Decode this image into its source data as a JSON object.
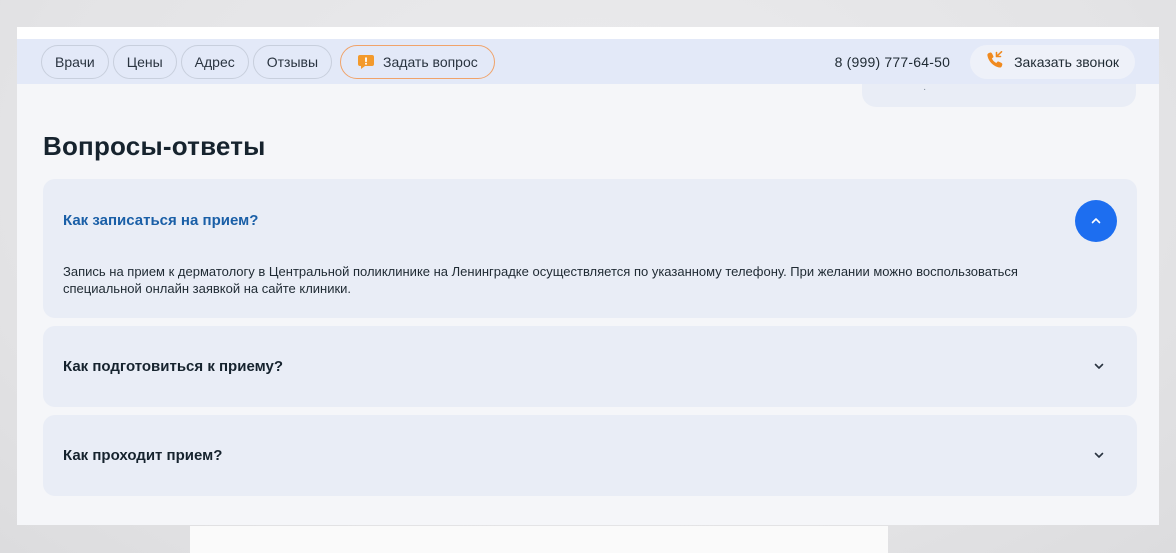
{
  "nav": {
    "items": [
      {
        "label": "Врачи"
      },
      {
        "label": "Цены"
      },
      {
        "label": "Адрес"
      },
      {
        "label": "Отзывы"
      }
    ],
    "ask_label": "Задать вопрос"
  },
  "header": {
    "phone": "8 (999) 777-64-50",
    "callback_label": "Заказать звонок"
  },
  "colors": {
    "accent_blue": "#1d6ef0",
    "question_open": "#1a5fa7",
    "ask_orange": "#f39a2c",
    "header_bg": "#e3e9f8",
    "item_bg": "#e9edf6"
  },
  "faq": {
    "title": "Вопросы-ответы",
    "items": [
      {
        "question": "Как записаться на прием?",
        "answer": "Запись на прием к дерматологу в Центральной поликлинике на Ленинградке осуществляется по указанному телефону. При желании можно воспользоваться специальной онлайн заявкой на сайте клиники.",
        "expanded": true,
        "icon": "chevron-up-icon"
      },
      {
        "question": "Как подготовиться к приему?",
        "expanded": false,
        "icon": "chevron-down-icon"
      },
      {
        "question": "Как проходит прием?",
        "expanded": false,
        "icon": "chevron-down-icon"
      }
    ]
  }
}
